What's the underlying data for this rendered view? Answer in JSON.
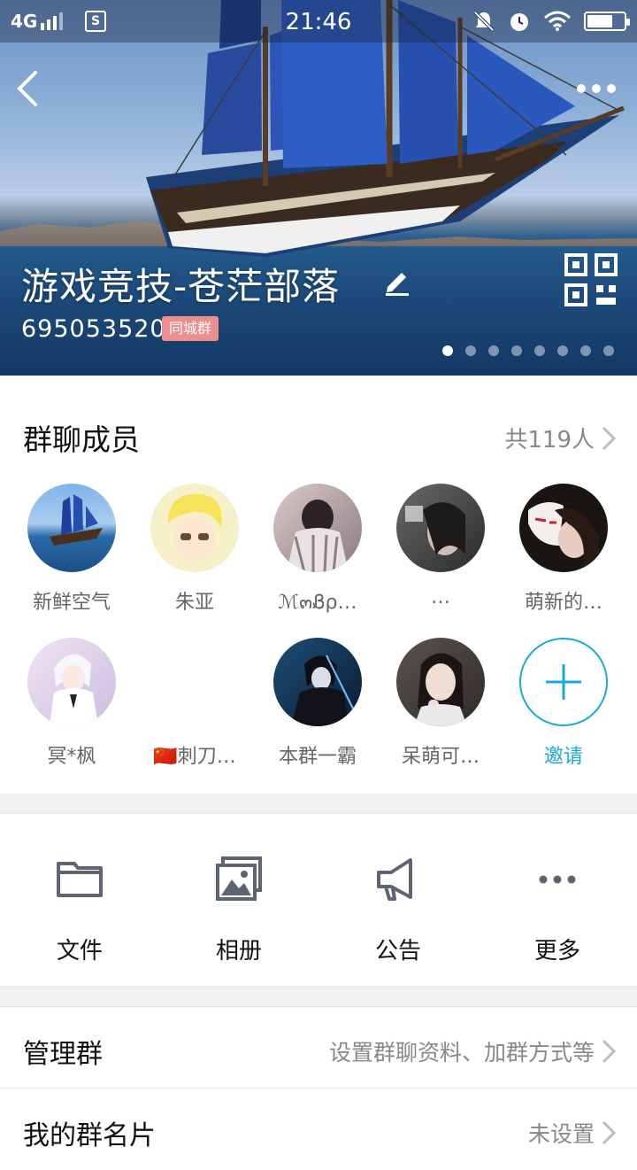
{
  "status_bar": {
    "network": "4G",
    "sim_icon": "S",
    "time": "21:46",
    "icons": [
      "bell-muted-icon",
      "alarm-icon",
      "wifi-icon",
      "battery-charging-icon"
    ],
    "battery_level": 0.7
  },
  "header": {
    "group_name": "游戏竞技-苍茫部落",
    "group_id": "695053520",
    "badge": "同城群",
    "carousel_pages": 8,
    "carousel_active": 0
  },
  "members": {
    "title": "群聊成员",
    "count_label": "共119人",
    "list": [
      {
        "name": "新鲜空气",
        "avatar": "sailing-ship"
      },
      {
        "name": "朱亚",
        "avatar": "cartoon-boy"
      },
      {
        "name": "ℳ๓Ᏸρ…",
        "avatar": "person-hoodie"
      },
      {
        "name": "…",
        "avatar": "girl-dark"
      },
      {
        "name": "萌新的…",
        "avatar": "fox-mask"
      },
      {
        "name": "冥*枫",
        "avatar": "anime-white-hair"
      },
      {
        "name": "🇨🇳刺刀…",
        "avatar": "blank"
      },
      {
        "name": "本群一霸",
        "avatar": "anime-dark-blue"
      },
      {
        "name": "呆萌可…",
        "avatar": "girl-short-hair"
      }
    ],
    "invite_label": "邀请"
  },
  "tools": [
    {
      "label": "文件",
      "icon": "folder-icon"
    },
    {
      "label": "相册",
      "icon": "album-icon"
    },
    {
      "label": "公告",
      "icon": "megaphone-icon"
    },
    {
      "label": "更多",
      "icon": "more-dots-icon"
    }
  ],
  "settings": {
    "manage": {
      "label": "管理群",
      "value": "设置群聊资料、加群方式等"
    },
    "card": {
      "label": "我的群名片",
      "value": "未设置"
    }
  },
  "colors": {
    "accent": "#18a8e0",
    "badge": "#ee8d8d",
    "icon_gray": "#5e6472"
  }
}
